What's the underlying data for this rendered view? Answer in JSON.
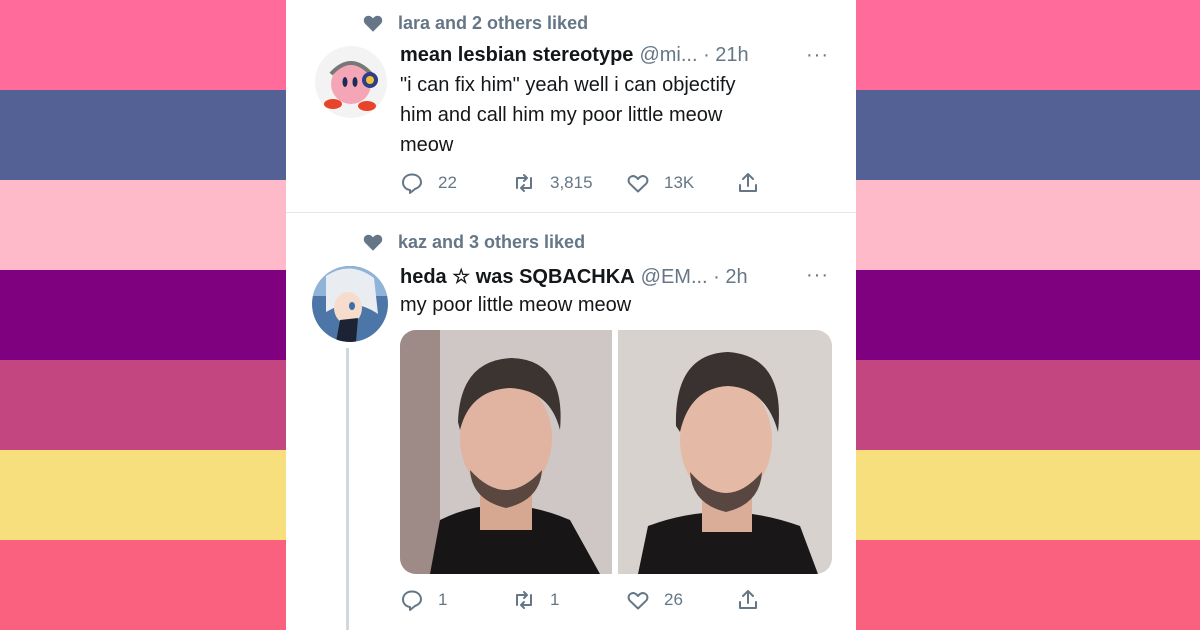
{
  "background": {
    "stripe_colors": [
      "#ff6b9a",
      "#546195",
      "#ffbaca",
      "#800180",
      "#c44680",
      "#f6df7c",
      "#f9617e"
    ]
  },
  "tweets": [
    {
      "social_context": "lara and 2 others liked",
      "display_name": "mean lesbian stereotype",
      "handle_time": "@mi... · 21h",
      "more": "···",
      "text_lines": [
        "\"i can fix him\" yeah well i can objectify",
        "him and call him my poor little meow",
        "meow"
      ],
      "replies": "22",
      "retweets": "3,815",
      "likes": "13K",
      "avatar_icon": "kirby-with-headphones-avatar"
    },
    {
      "social_context": "kaz and 3 others liked",
      "display_name": "heda ☆ was SQBACHKA",
      "handle_time": "@EM... · 2h",
      "more": "···",
      "text_lines": [
        "my poor little meow meow"
      ],
      "replies": "1",
      "retweets": "1",
      "likes": "26",
      "avatar_icon": "anime-character-avatar",
      "media": [
        "man-with-dark-hair-photo-left",
        "man-with-dark-hair-photo-right"
      ]
    }
  ],
  "icons": {
    "heart": "heart-icon",
    "reply": "reply-icon",
    "retweet": "retweet-icon",
    "like": "like-icon",
    "share": "share-icon"
  },
  "colors": {
    "text_primary": "#14171a",
    "text_secondary": "#657786",
    "card_bg": "#ffffff"
  }
}
